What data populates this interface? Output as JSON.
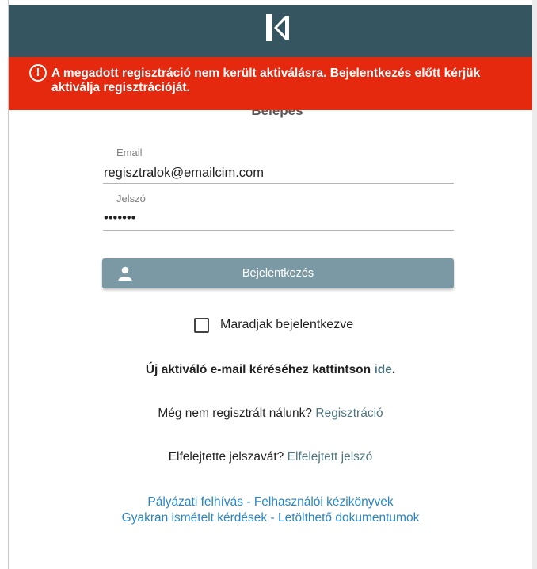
{
  "colors": {
    "header_bg": "#355560",
    "alert_bg": "#e5290f",
    "button_bg": "#7b99a4",
    "link_slate": "#4e7480",
    "link_blue": "#2a85c8"
  },
  "header": {
    "logo_icon": "k-logo-icon"
  },
  "alert": {
    "icon": "alert-circle-icon",
    "message": "A megadott regisztráció nem került aktiválásra. Bejelentkezés előtt kérjük aktiválja regisztrációját."
  },
  "form": {
    "heading": "Belépés",
    "email": {
      "label": "Email",
      "value": "regisztralok@emailcim.com"
    },
    "password": {
      "label": "Jelszó",
      "value": "•••••••"
    },
    "login_button": {
      "icon": "user-icon",
      "label": "Bejelentkezés"
    },
    "remember_me": {
      "label": "Maradjak bejelentkezve",
      "checked": false
    }
  },
  "activation": {
    "text": "Új aktiváló e-mail kéréséhez kattintson",
    "link": "ide",
    "suffix": "."
  },
  "register": {
    "text": "Még nem regisztrált nálunk?",
    "link": "Regisztráció"
  },
  "forgot": {
    "text": "Elfelejtette jelszavát?",
    "link": "Elfelejtett jelszó"
  },
  "footer": {
    "link1": "Pályázati felhívás",
    "link2": "Felhasználói kézikönyvek",
    "link3": "Gyakran ismételt kérdések",
    "link4": "Letölthető dokumentumok",
    "separator": "-"
  }
}
